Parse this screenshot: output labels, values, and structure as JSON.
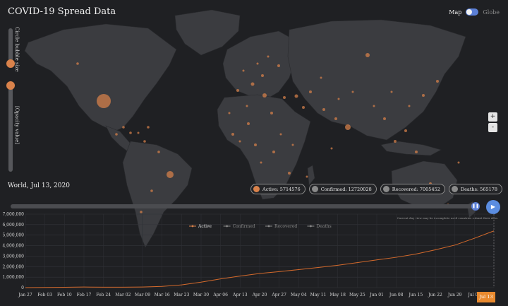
{
  "header": {
    "title": "COVID-19 Spread Data",
    "toggle_map": "Map",
    "toggle_globe": "Globe"
  },
  "sliders": {
    "circle_size_label": "Circle bubble size",
    "opacity_label": "[Opacity value]"
  },
  "zoom": {
    "in": "+",
    "out": "-"
  },
  "summary": {
    "place_date": "World, Jul 13, 2020",
    "active": "Active: 5714576",
    "confirmed": "Confirmed: 12720028",
    "recovered": "Recovered: 7005452",
    "deaths": "Deaths: 565178"
  },
  "timeline": {
    "play": "▶",
    "note": "Current day view may be incomplete until countries submit their data."
  },
  "colors": {
    "accent": "#d9824b",
    "ui_blue": "#5b7fd6",
    "line": "#d46a2c"
  },
  "chart_data": {
    "type": "line",
    "x": [
      "Jan 27",
      "Feb 03",
      "Feb 10",
      "Feb 17",
      "Feb 24",
      "Mar 02",
      "Mar 09",
      "Mar 16",
      "Mar 23",
      "Mar 30",
      "Apr 06",
      "Apr 13",
      "Apr 20",
      "Apr 27",
      "May 04",
      "May 11",
      "May 18",
      "May 25",
      "Jun 01",
      "Jun 08",
      "Jun 15",
      "Jun 22",
      "Jun 29",
      "Jul 06",
      "Jul 13"
    ],
    "ylim": [
      0,
      7000000
    ],
    "yticks": [
      "0",
      "1,000,000",
      "2,000,000",
      "3,000,000",
      "4,000,000",
      "5,000,000",
      "6,000,000",
      "7,000,000"
    ],
    "legend": [
      "Active",
      "Confirmed",
      "Recovered",
      "Deaths"
    ],
    "legend_position": "top-center",
    "series": [
      {
        "name": "Active",
        "values": [
          3000,
          18000,
          33000,
          57000,
          46000,
          42000,
          60000,
          115000,
          260000,
          520000,
          830000,
          1100000,
          1350000,
          1520000,
          1720000,
          1920000,
          2130000,
          2380000,
          2640000,
          2890000,
          3200000,
          3600000,
          4050000,
          4700000,
          5400000
        ]
      }
    ],
    "grid": true,
    "tooltip_x": "Jul 13"
  }
}
